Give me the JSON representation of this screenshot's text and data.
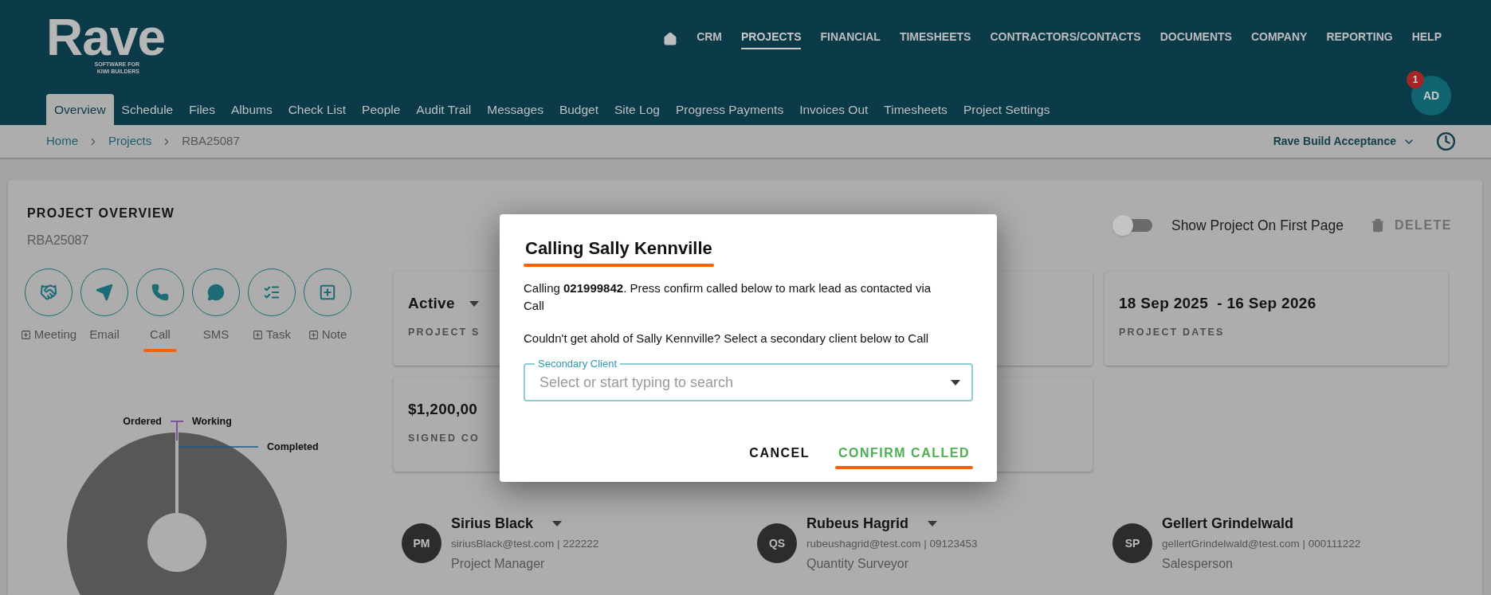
{
  "header": {
    "logo": {
      "name": "Rave",
      "tagline": [
        "SOFTWARE FOR",
        "KIWI BUILDERS"
      ]
    },
    "top_nav": [
      {
        "label": "CRM",
        "selected": false
      },
      {
        "label": "PROJECTS",
        "selected": true
      },
      {
        "label": "FINANCIAL",
        "selected": false
      },
      {
        "label": "TIMESHEETS",
        "selected": false
      },
      {
        "label": "CONTRACTORS/CONTACTS",
        "selected": false
      },
      {
        "label": "DOCUMENTS",
        "selected": false
      },
      {
        "label": "COMPANY",
        "selected": false
      },
      {
        "label": "REPORTING",
        "selected": false
      },
      {
        "label": "HELP",
        "selected": false
      }
    ],
    "tabs": [
      {
        "label": "Overview",
        "selected": true
      },
      {
        "label": "Schedule",
        "selected": false
      },
      {
        "label": "Files",
        "selected": false
      },
      {
        "label": "Albums",
        "selected": false
      },
      {
        "label": "Check List",
        "selected": false
      },
      {
        "label": "People",
        "selected": false
      },
      {
        "label": "Audit Trail",
        "selected": false
      },
      {
        "label": "Messages",
        "selected": false
      },
      {
        "label": "Budget",
        "selected": false
      },
      {
        "label": "Site Log",
        "selected": false
      },
      {
        "label": "Progress Payments",
        "selected": false
      },
      {
        "label": "Invoices Out",
        "selected": false
      },
      {
        "label": "Timesheets",
        "selected": false
      },
      {
        "label": "Project Settings",
        "selected": false
      }
    ],
    "avatar": {
      "initials": "AD",
      "badge": "1"
    }
  },
  "breadcrumb": {
    "items": [
      "Home",
      "Projects",
      "RBA25087"
    ],
    "project_selector": "Rave Build Acceptance"
  },
  "overview": {
    "title": "PROJECT OVERVIEW",
    "code": "RBA25087",
    "show_on_first_page": {
      "label": "Show Project On First Page",
      "on": false
    },
    "delete": {
      "label": "DELETE",
      "disabled": true
    },
    "actions": [
      {
        "label": "Meeting",
        "add": true,
        "underlined": false
      },
      {
        "label": "Email",
        "add": false,
        "underlined": false
      },
      {
        "label": "Call",
        "add": false,
        "underlined": true
      },
      {
        "label": "SMS",
        "add": false,
        "underlined": false
      },
      {
        "label": "Task",
        "add": true,
        "underlined": false
      },
      {
        "label": "Note",
        "add": true,
        "underlined": false
      }
    ],
    "chart": {
      "labels": [
        "Ordered",
        "Working",
        "Completed"
      ]
    },
    "cards": [
      {
        "kind": "stat",
        "value": "Active",
        "label": "PROJECT S",
        "dropdown": true
      },
      {
        "kind": "blank"
      },
      {
        "kind": "stat",
        "value": "18 Sep 2025  - 16 Sep 2026",
        "label": "PROJECT DATES",
        "dropdown": false
      },
      {
        "kind": "stat",
        "value": "$1,200,00",
        "label": "SIGNED CO"
      },
      {
        "kind": "blank"
      }
    ],
    "people": [
      {
        "initials": "PM",
        "name": "Sirius Black",
        "contact": "siriusBlack@test.com | 222222",
        "role": "Project Manager",
        "dropdown": true
      },
      {
        "initials": "QS",
        "name": "Rubeus Hagrid",
        "contact": "rubeushagrid@test.com | 09123453",
        "role": "Quantity Surveyor",
        "dropdown": true
      },
      {
        "initials": "SP",
        "name": "Gellert Grindelwald",
        "contact": "gellertGrindelwald@test.com | 000111222",
        "role": "Salesperson",
        "dropdown": false
      }
    ]
  },
  "dialog": {
    "title": "Calling Sally Kennville",
    "title_underlined": true,
    "message": "Calling **021999842**. Press confirm called below to mark lead as contacted via Call",
    "prompt": "Couldn't get ahold of Sally Kennville? Select a secondary client below to Call",
    "field": {
      "label": "Secondary Client",
      "placeholder": "Select or start typing to search"
    },
    "buttons": [
      {
        "label": "CANCEL",
        "kind": "plain",
        "underlined": false
      },
      {
        "label": "CONFIRM CALLED",
        "kind": "confirm",
        "underlined": true
      }
    ]
  }
}
